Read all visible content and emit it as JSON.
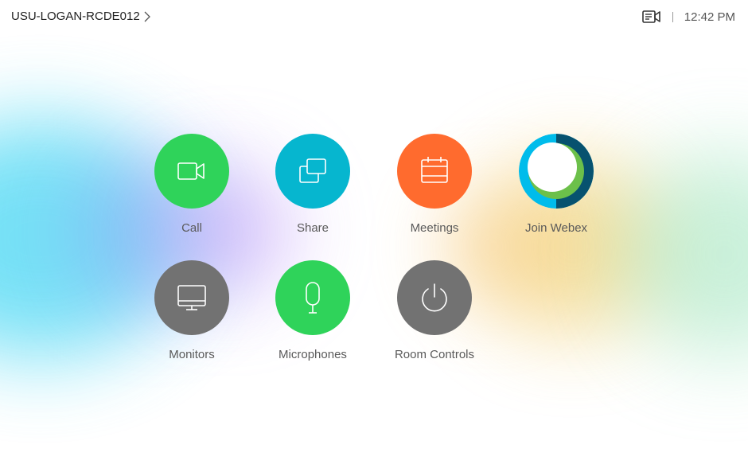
{
  "header": {
    "room_name": "USU-LOGAN-RCDE012",
    "time": "12:42 PM"
  },
  "tiles": [
    {
      "label": "Call",
      "icon": "video-camera-icon",
      "color": "#2fd35a"
    },
    {
      "label": "Share",
      "icon": "share-screens-icon",
      "color": "#06b6cf"
    },
    {
      "label": "Meetings",
      "icon": "calendar-icon",
      "color": "#ff6b2e"
    },
    {
      "label": "Join Webex",
      "icon": "webex-logo-icon",
      "color": "#00bceb"
    },
    {
      "label": "Monitors",
      "icon": "monitor-icon",
      "color": "#727272"
    },
    {
      "label": "Microphones",
      "icon": "microphone-icon",
      "color": "#2fd35a"
    },
    {
      "label": "Room Controls",
      "icon": "power-icon",
      "color": "#727272"
    }
  ],
  "colors": {
    "background": "#ffffff",
    "gray_button": "#727272",
    "green_button": "#2fd35a",
    "teal_button": "#06b6cf",
    "orange_button": "#ff6b2e",
    "webex_dark": "#07526f",
    "webex_green": "#6cc04a"
  }
}
